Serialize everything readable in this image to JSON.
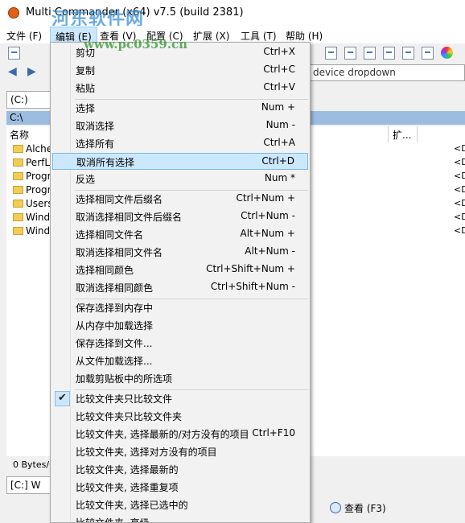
{
  "window": {
    "title": "Multi Commander (x64)  v7.5 (build 2381)"
  },
  "watermark": {
    "line1": "河东软件网",
    "line2": "www.pc0359.cn"
  },
  "menubar": {
    "items": [
      {
        "label": "文件 (F)"
      },
      {
        "label": "编辑 (E)"
      },
      {
        "label": "查看 (V)"
      },
      {
        "label": "配置 (C)"
      },
      {
        "label": "扩展 (X)"
      },
      {
        "label": "工具 (T)"
      },
      {
        "label": "帮助 (H)"
      }
    ],
    "active_index": 1
  },
  "toolbar": {
    "icons": [
      "kb-icon",
      "doc-icon",
      "doc-icon",
      "doc-icon",
      "doc-icon",
      "notes-icon",
      "doc-icon",
      "color-wheel-icon"
    ]
  },
  "nav": {
    "device_placeholder": "device dropdown"
  },
  "left_panel": {
    "drive_tab": "(C:) ",
    "path": "C:\\",
    "columns": {
      "name": "名称",
      "ext": "扩..."
    },
    "files": [
      {
        "name": "Alcher",
        "type": "<D"
      },
      {
        "name": "PerfLo",
        "type": "<D"
      },
      {
        "name": "Progra",
        "type": "<D"
      },
      {
        "name": "Progra",
        "type": "<D"
      },
      {
        "name": "Users",
        "type": "<D"
      },
      {
        "name": "Windo",
        "type": "<D"
      },
      {
        "name": "Windo",
        "type": "<D"
      }
    ],
    "status": "0 Bytes/0",
    "bottom_tab": "[C:] W",
    "view_button": "查看 (F3)"
  },
  "edit_menu": {
    "items": [
      {
        "label": "剪切",
        "shortcut": "Ctrl+X"
      },
      {
        "label": "复制",
        "shortcut": "Ctrl+C"
      },
      {
        "label": "粘贴",
        "shortcut": "Ctrl+V"
      },
      {
        "label": "选择",
        "shortcut": "Num +"
      },
      {
        "label": "取消选择",
        "shortcut": "Num -"
      },
      {
        "label": "选择所有",
        "shortcut": "Ctrl+A"
      },
      {
        "label": "取消所有选择",
        "shortcut": "Ctrl+D",
        "highlighted": true
      },
      {
        "label": "反选",
        "shortcut": "Num *"
      },
      {
        "label": "选择相同文件后缀名",
        "shortcut": "Ctrl+Num +"
      },
      {
        "label": "取消选择相同文件后缀名",
        "shortcut": "Ctrl+Num -"
      },
      {
        "label": "选择相同文件名",
        "shortcut": "Alt+Num +"
      },
      {
        "label": "取消选择相同文件名",
        "shortcut": "Alt+Num -"
      },
      {
        "label": "选择相同颜色",
        "shortcut": "Ctrl+Shift+Num +"
      },
      {
        "label": "取消选择相同颜色",
        "shortcut": "Ctrl+Shift+Num -"
      },
      {
        "label": "保存选择到内存中",
        "shortcut": ""
      },
      {
        "label": "从内存中加载选择",
        "shortcut": ""
      },
      {
        "label": "保存选择到文件...",
        "shortcut": ""
      },
      {
        "label": "从文件加载选择...",
        "shortcut": ""
      },
      {
        "label": "加载剪贴板中的所选项",
        "shortcut": ""
      },
      {
        "label": "比较文件夹只比较文件",
        "shortcut": "",
        "checked": true
      },
      {
        "label": "比较文件夹只比较文件夹",
        "shortcut": ""
      },
      {
        "label": "比较文件夹, 选择最新的/对方没有的项目",
        "shortcut": "Ctrl+F10"
      },
      {
        "label": "比较文件夹, 选择对方没有的项目",
        "shortcut": ""
      },
      {
        "label": "比较文件夹, 选择最新的",
        "shortcut": ""
      },
      {
        "label": "比较文件夹, 选择重复项",
        "shortcut": ""
      },
      {
        "label": "比较文件夹, 选择已选中的",
        "shortcut": ""
      },
      {
        "label": "比较文件夹, 高级...",
        "shortcut": ""
      }
    ]
  }
}
